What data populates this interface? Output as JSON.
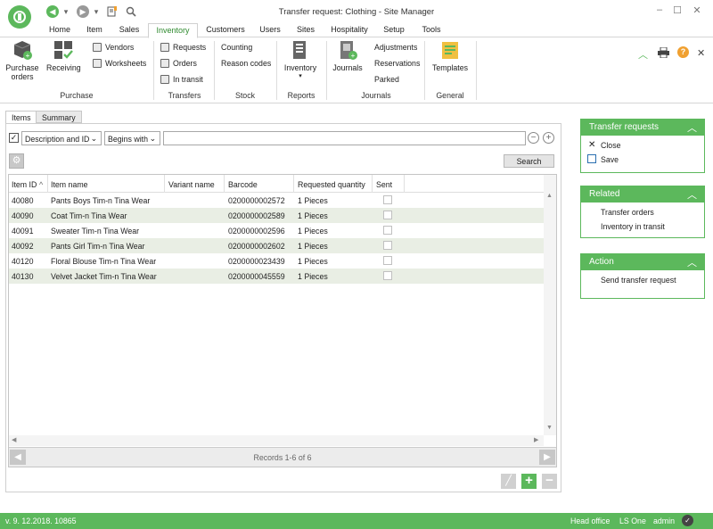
{
  "window": {
    "title": "Transfer request: Clothing - Site Manager"
  },
  "tabs": [
    "Home",
    "Item",
    "Sales",
    "Inventory",
    "Customers",
    "Users",
    "Sites",
    "Hospitality",
    "Setup",
    "Tools"
  ],
  "ribbon": {
    "purchase_orders": "Purchase\norders",
    "receiving": "Receiving",
    "vendors": "Vendors",
    "worksheets": "Worksheets",
    "purchase_group": "Purchase",
    "requests": "Requests",
    "orders": "Orders",
    "in_transit": "In transit",
    "transfers_group": "Transfers",
    "counting": "Counting",
    "reason_codes": "Reason codes",
    "stock_group": "Stock",
    "inventory": "Inventory",
    "reports_group": "Reports",
    "journals": "Journals",
    "adjustments": "Adjustments",
    "reservations": "Reservations",
    "parked": "Parked",
    "journals_group": "Journals",
    "templates": "Templates",
    "general_group": "General"
  },
  "panel_tabs": [
    "Items",
    "Summary"
  ],
  "filter": {
    "field": "Description and ID",
    "mode": "Begins with",
    "search_value": "",
    "search_button": "Search"
  },
  "grid": {
    "columns": [
      "Item ID",
      "Item name",
      "Variant name",
      "Barcode",
      "Requested quantity",
      "Sent"
    ],
    "rows": [
      {
        "id": "40080",
        "name": "Pants Boys Tim-n Tina Wear",
        "variant": "",
        "barcode": "0200000002572",
        "qty": "1 Pieces",
        "sent": false
      },
      {
        "id": "40090",
        "name": "Coat Tim-n Tina Wear",
        "variant": "",
        "barcode": "0200000002589",
        "qty": "1 Pieces",
        "sent": false
      },
      {
        "id": "40091",
        "name": "Sweater Tim-n Tina Wear",
        "variant": "",
        "barcode": "0200000002596",
        "qty": "1 Pieces",
        "sent": false
      },
      {
        "id": "40092",
        "name": "Pants Girl Tim-n Tina Wear",
        "variant": "",
        "barcode": "0200000002602",
        "qty": "1 Pieces",
        "sent": false
      },
      {
        "id": "40120",
        "name": "Floral Blouse Tim-n Tina Wear",
        "variant": "",
        "barcode": "0200000023439",
        "qty": "1 Pieces",
        "sent": false
      },
      {
        "id": "40130",
        "name": "Velvet Jacket Tim-n Tina Wear",
        "variant": "",
        "barcode": "0200000045559",
        "qty": "1 Pieces",
        "sent": false
      }
    ],
    "records": "Records 1-6 of 6"
  },
  "side": {
    "transfer_requests": {
      "title": "Transfer requests",
      "close": "Close",
      "save": "Save"
    },
    "related": {
      "title": "Related",
      "transfer_orders": "Transfer orders",
      "inventory_in_transit": "Inventory in transit"
    },
    "action": {
      "title": "Action",
      "send": "Send transfer request"
    }
  },
  "status": {
    "version": "v. 9. 12.2018. 10865",
    "office": "Head office",
    "product": "LS One",
    "user": "admin"
  },
  "colors": {
    "accent": "#5cb85c",
    "alt_row": "#e9eee4"
  }
}
